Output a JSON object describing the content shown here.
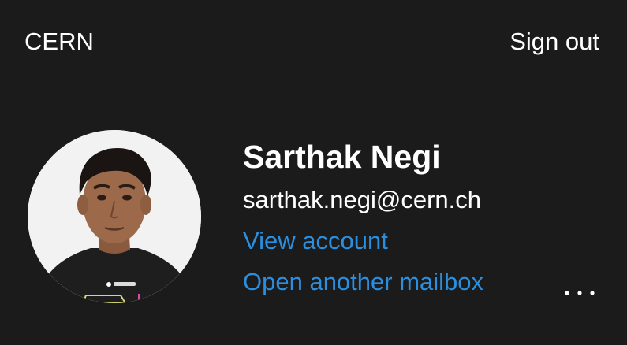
{
  "header": {
    "org_name": "CERN",
    "sign_out_label": "Sign out"
  },
  "account": {
    "name": "Sarthak Negi",
    "email": "sarthak.negi@cern.ch",
    "view_account_label": "View account",
    "open_mailbox_label": "Open another mailbox",
    "more_label": "..."
  },
  "icons": {
    "avatar": "profile-photo",
    "more": "more-options-icon"
  },
  "colors": {
    "background": "#1b1b1b",
    "text": "#ffffff",
    "link": "#2b8fe0"
  }
}
